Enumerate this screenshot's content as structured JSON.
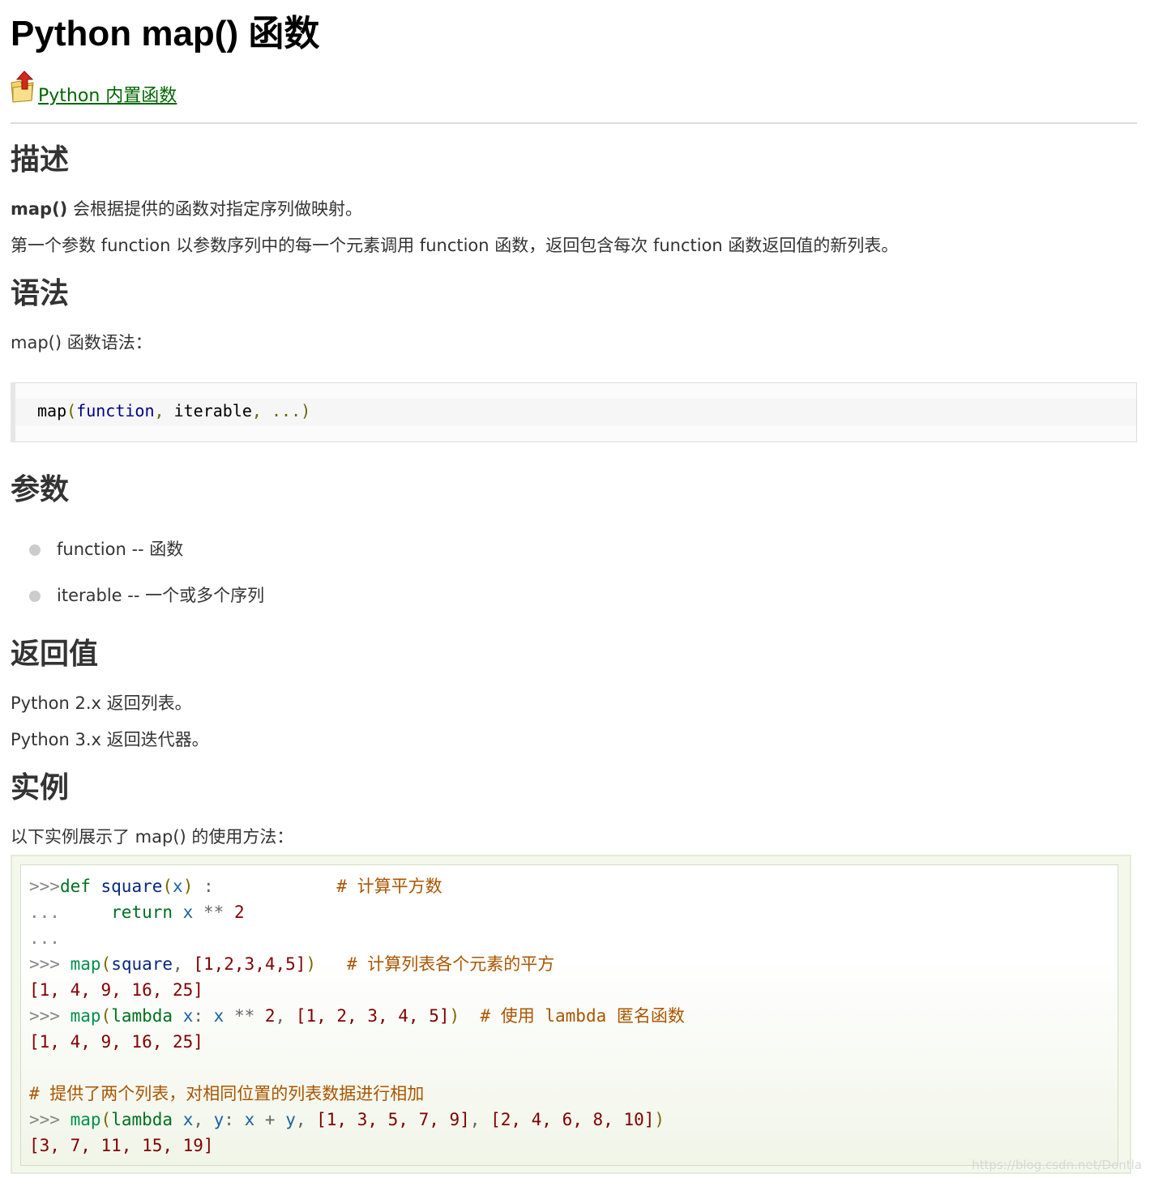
{
  "title": "Python map() 函数",
  "back_link": "Python 内置函数",
  "sections": {
    "desc_title": "描述",
    "desc_bold": "map()",
    "desc_line1_rest": " 会根据提供的函数对指定序列做映射。",
    "desc_line2": "第一个参数 function 以参数序列中的每一个元素调用 function 函数，返回包含每次 function 函数返回值的新列表。",
    "syntax_title": "语法",
    "syntax_intro": "map() 函数语法：",
    "syntax_code": {
      "name": "map",
      "open": "(",
      "arg1": "function",
      "sep1": ", ",
      "arg2": "iterable",
      "sep2": ", ",
      "rest": "...)"
    },
    "params_title": "参数",
    "params": [
      "function -- 函数",
      "iterable -- 一个或多个序列"
    ],
    "return_title": "返回值",
    "return_py2": "Python 2.x 返回列表。",
    "return_py3": "Python 3.x 返回迭代器。",
    "example_title": "实例",
    "example_intro": "以下实例展示了 map() 的使用方法："
  },
  "example_code": {
    "l1_prompt": ">>>",
    "l1_def": "def",
    "l1_name": " square",
    "l1_paren_open": "(",
    "l1_arg": "x",
    "l1_paren_close": ")",
    "l1_colon": " :",
    "l1_comment": "# 计算平方数",
    "l2_prompt": "...",
    "l2_return": "return",
    "l2_x": "x",
    "l2_op": "**",
    "l2_num": "2",
    "l3_prompt": "...",
    "l4_prompt": ">>>",
    "l4_map": "map",
    "l4_open": "(",
    "l4_arg": "square",
    "l4_sep": ", ",
    "l4_list": "[1,2,3,4,5]",
    "l4_close": ")",
    "l4_comment": "# 计算列表各个元素的平方",
    "l5_out": "[1, 4, 9, 16, 25]",
    "l6_prompt": ">>>",
    "l6_map": "map",
    "l6_open": "(",
    "l6_lambda": "lambda",
    "l6_x": " x",
    "l6_colon": ":",
    "l6_x2": " x",
    "l6_op": " **",
    "l6_num": " 2",
    "l6_sep": ", ",
    "l6_list": "[1, 2, 3, 4, 5]",
    "l6_close": ")",
    "l6_comment": "# 使用 lambda 匿名函数",
    "l7_out": "[1, 4, 9, 16, 25]",
    "l9_comment": "# 提供了两个列表，对相同位置的列表数据进行相加",
    "l10_prompt": ">>>",
    "l10_map": "map",
    "l10_open": "(",
    "l10_lambda": "lambda",
    "l10_x": " x",
    "l10_comma": ",",
    "l10_y": " y",
    "l10_colon": ":",
    "l10_x2": " x",
    "l10_plus": " +",
    "l10_y2": " y",
    "l10_sep1": ", ",
    "l10_list1": "[1, 3, 5, 7, 9]",
    "l10_sep2": ", ",
    "l10_list2": "[2, 4, 6, 8, 10]",
    "l10_close": ")",
    "l11_out": "[3, 7, 11, 15, 19]"
  },
  "watermark": "https://blog.csdn.net/Dontla",
  "colors": {
    "link": "#006600",
    "keyword": "#007020",
    "number": "#800000",
    "comment": "#aa5500"
  }
}
